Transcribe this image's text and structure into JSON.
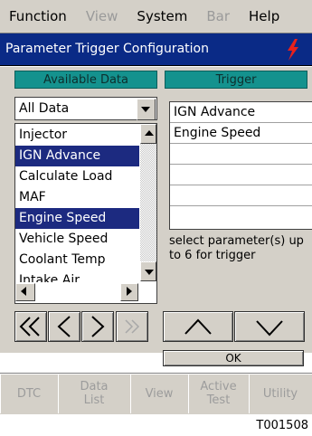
{
  "menu": {
    "items": [
      {
        "label": "Function",
        "enabled": true
      },
      {
        "label": "View",
        "enabled": false
      },
      {
        "label": "System",
        "enabled": true
      },
      {
        "label": "Bar",
        "enabled": false
      },
      {
        "label": "Help",
        "enabled": true
      }
    ]
  },
  "window": {
    "title": "Parameter Trigger Configuration",
    "title_bg": "#0a2a86",
    "icon": "lightning-bolt-icon",
    "icon_color": "#e8211c"
  },
  "headers": {
    "available": "Available Data",
    "trigger": "Trigger",
    "color": "#14928e"
  },
  "filter": {
    "selected": "All Data"
  },
  "available_list": {
    "items": [
      {
        "label": "Injector",
        "selected": false
      },
      {
        "label": "IGN Advance",
        "selected": true
      },
      {
        "label": "Calculate Load",
        "selected": false
      },
      {
        "label": "MAF",
        "selected": false
      },
      {
        "label": "Engine Speed",
        "selected": true
      },
      {
        "label": "Vehicle Speed",
        "selected": false
      },
      {
        "label": "Coolant Temp",
        "selected": false
      },
      {
        "label": "Intake Air",
        "selected": false
      }
    ],
    "selection_color": "#1c2a80"
  },
  "trigger_list": {
    "items": [
      "IGN Advance",
      "Engine Speed",
      "",
      "",
      "",
      ""
    ]
  },
  "hint": "select parameter(s) up\nto 6 for trigger",
  "nav_buttons": [
    {
      "name": "first-page-button",
      "icon": "double-chevron-left-icon",
      "enabled": true
    },
    {
      "name": "previous-button",
      "icon": "chevron-left-icon",
      "enabled": true
    },
    {
      "name": "next-button",
      "icon": "chevron-right-icon",
      "enabled": true
    },
    {
      "name": "last-page-button",
      "icon": "double-chevron-right-icon",
      "enabled": false
    },
    {
      "name": "move-up-button",
      "icon": "chevron-up-icon",
      "enabled": true
    },
    {
      "name": "move-down-button",
      "icon": "chevron-down-icon",
      "enabled": true
    }
  ],
  "ok_label": "OK",
  "tabs": [
    "DTC",
    "Data\nList",
    "View",
    "Active\nTest",
    "Utility"
  ],
  "figure_code": "T001508"
}
